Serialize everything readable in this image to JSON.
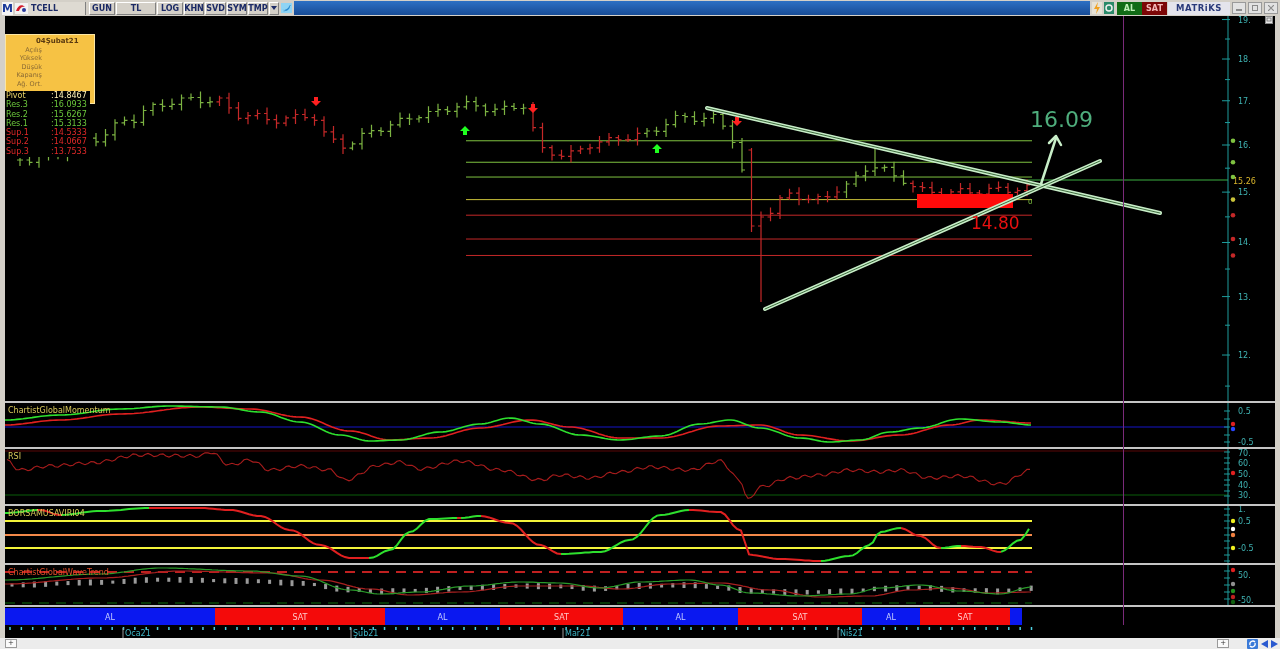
{
  "toolbar": {
    "logo": "M",
    "symbol": "TCELL",
    "buttons": [
      "GUN",
      "TL",
      "LOG",
      "KHN",
      "SVD",
      "SYM",
      "TMP"
    ],
    "trade_buttons": [
      {
        "label": "AL",
        "kind": "buy"
      },
      {
        "label": "SAT",
        "kind": "sell"
      }
    ],
    "brand": "MATRiKS"
  },
  "info_box": {
    "date": "04Şubat21",
    "fields": [
      "Açılış",
      "Yüksek",
      "Düşük",
      "Kapanış",
      "Ağ. Ort."
    ]
  },
  "pivot_table": [
    {
      "label": "Pivot",
      "value": ":14.8467",
      "kind": "pivot"
    },
    {
      "label": "Res.3",
      "value": ":16.0933",
      "kind": "resistance"
    },
    {
      "label": "Res.2",
      "value": ":15.6267",
      "kind": "resistance"
    },
    {
      "label": "Res.1",
      "value": ":15.3133",
      "kind": "resistance"
    },
    {
      "label": "Sup.1",
      "value": ":14.5333",
      "kind": "support"
    },
    {
      "label": "Sup.2",
      "value": ":14.0667",
      "kind": "support"
    },
    {
      "label": "Sup.3",
      "value": ":13.7533",
      "kind": "support"
    }
  ],
  "main_chart": {
    "axis_labels": [
      "19.",
      "18.",
      "17.",
      "16.",
      "15.",
      "14.",
      "13.",
      "12."
    ],
    "last_price": "15.26",
    "target_label": "16.09",
    "box_label": "14.80",
    "pivot_end_label": "0"
  },
  "indicators": [
    {
      "kind": "momentum",
      "title": "ChartistGlobalMomentum",
      "axis_labels": [
        "0.5",
        "-0.5"
      ]
    },
    {
      "kind": "rsi",
      "title": "RSI",
      "axis_labels": [
        "70.",
        "60.",
        "50.",
        "40.",
        "30."
      ]
    },
    {
      "kind": "oscillator",
      "title": "BORSAMUSAVIRI04",
      "axis_labels": [
        "1.",
        "0.5",
        "-0.5"
      ]
    },
    {
      "kind": "wavetrend",
      "title": "ChartistGlobalWaveTrend",
      "axis_labels": [
        "50.",
        "-50."
      ]
    }
  ],
  "signal_band": [
    {
      "label": "AL",
      "kind": "buy"
    },
    {
      "label": "SAT",
      "kind": "sell"
    },
    {
      "label": "AL",
      "kind": "buy"
    },
    {
      "label": "SAT",
      "kind": "sell"
    },
    {
      "label": "AL",
      "kind": "buy"
    },
    {
      "label": "SAT",
      "kind": "sell"
    },
    {
      "label": "AL",
      "kind": "buy"
    },
    {
      "label": "SAT",
      "kind": "sell"
    },
    {
      "kind": "buy"
    }
  ],
  "date_labels": [
    "Oca21",
    "Şub21",
    "Mar21",
    "Nis21"
  ],
  "status_bar": {
    "buttons": [
      "+",
      "+"
    ]
  }
}
